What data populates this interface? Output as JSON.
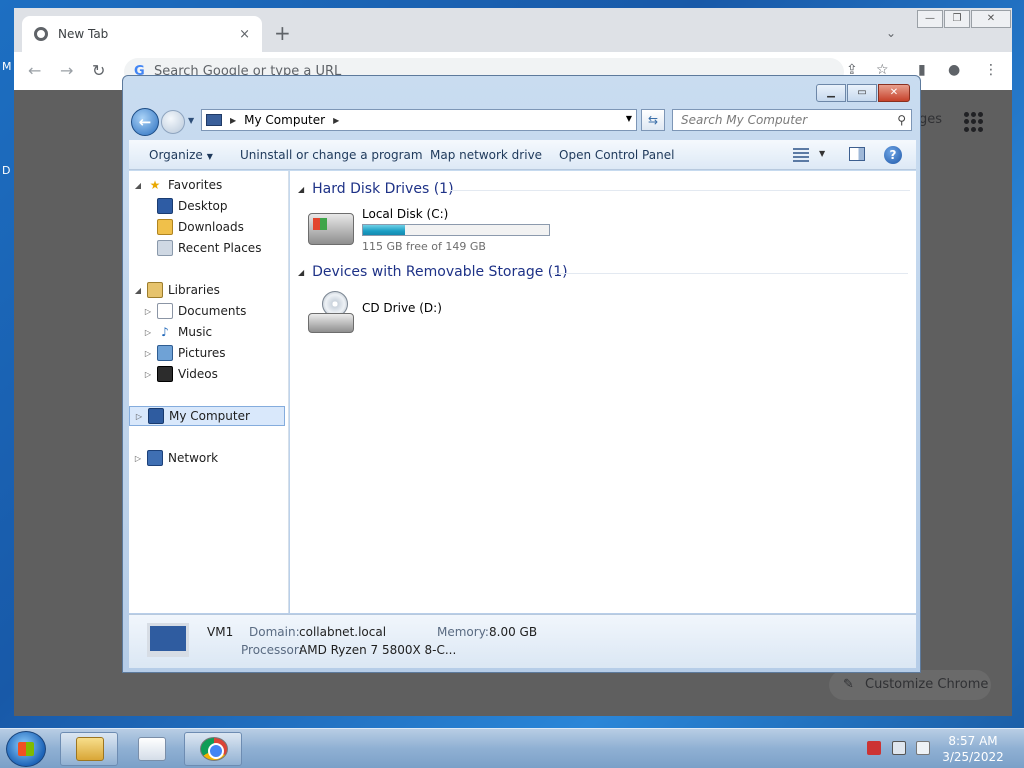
{
  "desktop": {
    "frag1": "M",
    "frag2": "D"
  },
  "chrome": {
    "tab_title": "New Tab",
    "tab_close": "×",
    "new_tab": "+",
    "tab_menu": "⌄",
    "win_min": "—",
    "win_max": "❐",
    "win_close": "✕",
    "omnibox_placeholder": "Search Google or type a URL",
    "images_link": "ges",
    "customize_label": "Customize Chrome"
  },
  "explorer": {
    "address": "My Computer",
    "search_placeholder": "Search My Computer",
    "toolbar": {
      "organize": "Organize",
      "uninstall": "Uninstall or change a program",
      "map_drive": "Map network drive",
      "control_panel": "Open Control Panel"
    },
    "nav": {
      "favorites": "Favorites",
      "desktop": "Desktop",
      "downloads": "Downloads",
      "recent": "Recent Places",
      "libraries": "Libraries",
      "documents": "Documents",
      "music": "Music",
      "pictures": "Pictures",
      "videos": "Videos",
      "my_computer": "My Computer",
      "network": "Network"
    },
    "groups": {
      "hdd": "Hard Disk Drives (1)",
      "removable": "Devices with Removable Storage (1)"
    },
    "drives": {
      "c_name": "Local Disk (C:)",
      "c_free": "115 GB free of 149 GB",
      "c_used_fraction": 0.228,
      "d_name": "CD Drive (D:)"
    },
    "details": {
      "name": "VM1",
      "domain_label": "Domain:",
      "domain_value": "collabnet.local",
      "memory_label": "Memory:",
      "memory_value": "8.00 GB",
      "processor_label": "Processor:",
      "processor_value": "AMD Ryzen 7 5800X 8-C..."
    }
  },
  "taskbar": {
    "time": "8:57 AM",
    "date": "3/25/2022"
  }
}
